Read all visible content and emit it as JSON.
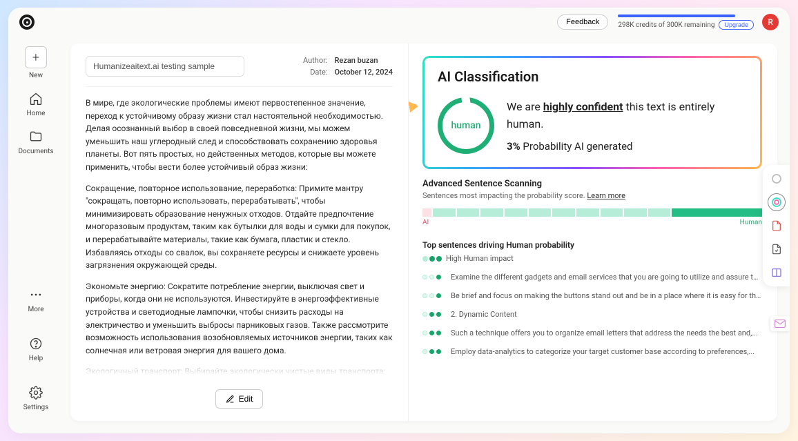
{
  "topbar": {
    "feedback_label": "Feedback",
    "credits_text": "298K credits of 300K remaining",
    "upgrade_label": "Upgrade",
    "avatar_initial": "R"
  },
  "sidebar": {
    "new_label": "New",
    "items": [
      {
        "label": "Home",
        "icon": "home"
      },
      {
        "label": "Documents",
        "icon": "folder"
      }
    ],
    "bottom": [
      {
        "label": "More",
        "icon": "more"
      },
      {
        "label": "Help",
        "icon": "help"
      },
      {
        "label": "Settings",
        "icon": "gear"
      }
    ]
  },
  "document": {
    "title": "Humanizeaitext.ai testing sample",
    "author_label": "Author:",
    "author": "Rezan buzan",
    "date_label": "Date:",
    "date": "October 12, 2024",
    "paragraphs": [
      "В мире, где экологические проблемы имеют первостепенное значение, переход к устойчивому образу жизни стал настоятельной необходимостью. Делая осознанный выбор в своей повседневной жизни, мы можем уменьшить наш углеродный след и способствовать сохранению здоровья планеты. Вот пять простых, но действенных методов, которые вы можете применить, чтобы вести более устойчивый образ жизни:",
      "Сокращение, повторное использование, переработка: Примите мантру \"сокращать, повторно использовать, перерабатывать\", чтобы минимизировать образование ненужных отходов. Отдайте предпочтение многоразовым продуктам, таким как бутылки для воды и сумки для покупок, и перерабатывайте материалы, такие как бумага, пластик и стекло. Избавляясь отходы со свалок, вы сохраняете ресурсы и снижаете уровень загрязнения окружающей среды.",
      "Экономьте энергию: Сократите потребление энергии, выключая свет и приборы, когда они не используются. Инвестируйте в энергоэффективные устройства и светодиодные лампочки, чтобы снизить расходы на электричество и уменьшить выбросы парниковых газов. Также рассмотрите возможность использования возобновляемых источников энергии, таких как солнечная или ветровая энергия для вашего дома.",
      "Экологичный транспорт: Выбирайте экологически чистые виды транспорта: ходите пешком, ездите на велосипеде или пользуйтесь общественным транспортом, если это возможно. Совместное использование автомобилей и объединение поручений также снижает потребление топлива и загрязнение воздуха, принося пользу как окружающей среде, так и вашему бюджету."
    ],
    "edit_label": "Edit"
  },
  "classification": {
    "title": "AI Classification",
    "badge_text": "human",
    "confidence_prefix": "We are ",
    "confidence_strong": "highly confident",
    "confidence_suffix": " this text is entirely human.",
    "probability_value": "3%",
    "probability_suffix": " Probability AI generated"
  },
  "scanning": {
    "title": "Advanced Sentence Scanning",
    "subtitle": "Sentences most impacting the probability score. ",
    "learn_more": "Learn more",
    "label_ai": "AI",
    "label_human": "Human"
  },
  "driving": {
    "title": "Top sentences driving Human probability",
    "impact_label": "High Human impact",
    "sentences": [
      "Examine the different gadgets and email services that you are going to utilize and assure that...",
      "Be brief and focus on making the buttons stand out and be in a place where it is easy for the...",
      "2. Dynamic Content",
      "Such a technique offers you to organize email letters that address the needs the best and,...",
      "Employ data-analytics to categorize your target customer base according to preferences,..."
    ]
  }
}
